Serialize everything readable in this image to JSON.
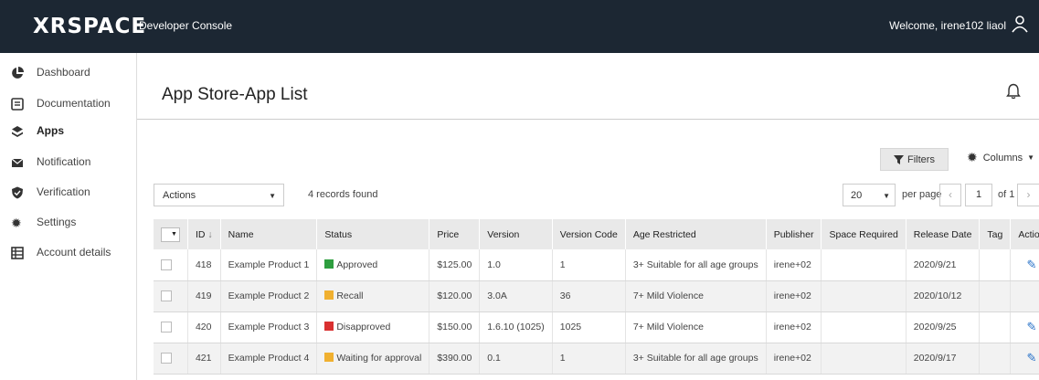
{
  "header": {
    "logo": "XRSPACE",
    "console_title": "Developer Console",
    "welcome": "Welcome, irene102 liaol"
  },
  "sidebar": {
    "items": [
      {
        "label": "Dashboard",
        "icon": "pie-chart-icon"
      },
      {
        "label": "Documentation",
        "icon": "document-icon"
      },
      {
        "label": "Apps",
        "icon": "apps-icon",
        "active": true
      },
      {
        "label": "Notification",
        "icon": "envelope-icon"
      },
      {
        "label": "Verification",
        "icon": "shield-icon"
      },
      {
        "label": "Settings",
        "icon": "gear-icon"
      },
      {
        "label": "Account details",
        "icon": "table-icon"
      }
    ]
  },
  "page": {
    "title": "App Store-App List"
  },
  "toolbar": {
    "filters_label": "Filters",
    "columns_label": "Columns",
    "actions_value": "Actions",
    "records_found": "4 records found",
    "per_page_value": "20",
    "per_page_label": "per page",
    "page_number": "1",
    "of_pages": "of 1"
  },
  "table": {
    "headers": [
      "ID",
      "Name",
      "Status",
      "Price",
      "Version",
      "Version Code",
      "Age Restricted",
      "Publisher",
      "Space Required",
      "Release Date",
      "Tag",
      "Action"
    ],
    "sort_indicator": "↓",
    "rows": [
      {
        "id": "418",
        "name": "Example Product 1",
        "status": "Approved",
        "status_color": "#2e9e3f",
        "price": "$125.00",
        "version": "1.0",
        "version_code": "1",
        "age": "3+ Suitable for all age groups",
        "publisher": "irene+02",
        "space": "",
        "release": "2020/9/21",
        "tag": "",
        "editable": true
      },
      {
        "id": "419",
        "name": "Example Product 2",
        "status": "Recall",
        "status_color": "#f0b030",
        "price": "$120.00",
        "version": "3.0A",
        "version_code": "36",
        "age": "7+ Mild Violence",
        "publisher": "irene+02",
        "space": "",
        "release": "2020/10/12",
        "tag": "",
        "editable": false
      },
      {
        "id": "420",
        "name": "Example Product 3",
        "status": "Disapproved",
        "status_color": "#d93030",
        "price": "$150.00",
        "version": "1.6.10 (1025)",
        "version_code": "1025",
        "age": "7+ Mild Violence",
        "publisher": "irene+02",
        "space": "",
        "release": "2020/9/25",
        "tag": "",
        "editable": true
      },
      {
        "id": "421",
        "name": "Example Product 4",
        "status": "Waiting for approval",
        "status_color": "#f0b030",
        "price": "$390.00",
        "version": "0.1",
        "version_code": "1",
        "age": "3+ Suitable for all age groups",
        "publisher": "irene+02",
        "space": "",
        "release": "2020/9/17",
        "tag": "",
        "editable": true
      }
    ]
  },
  "colors": {
    "topbar": "#1c2733",
    "accent_edit": "#2a73c8"
  }
}
